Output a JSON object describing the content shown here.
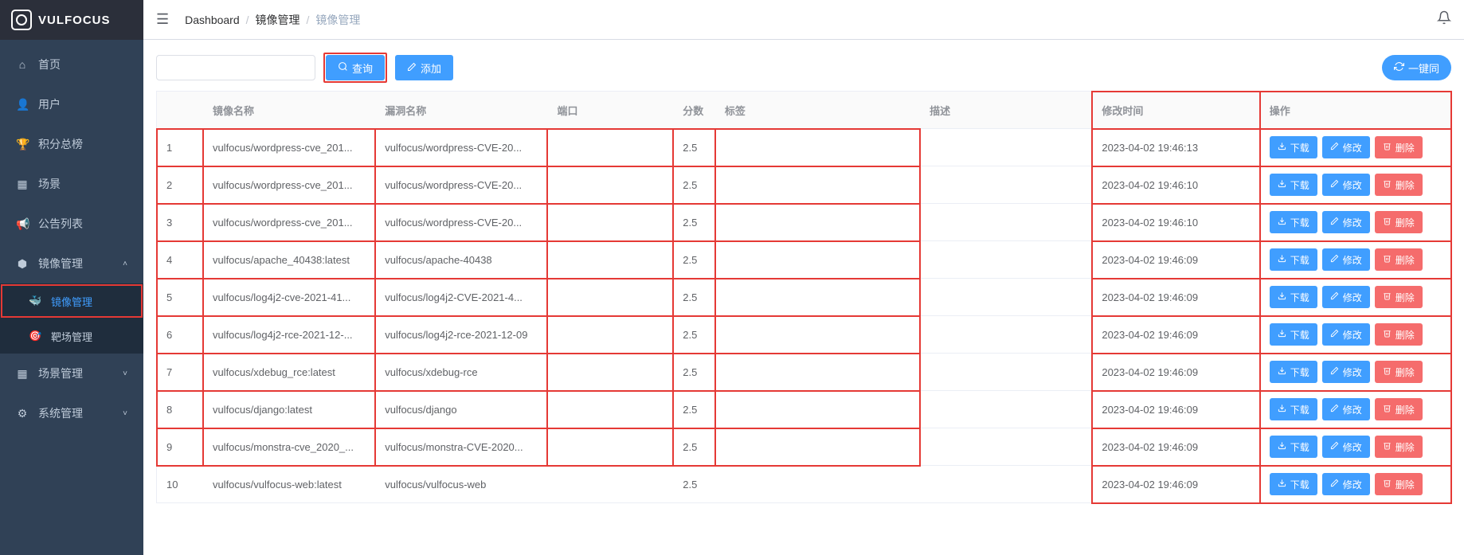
{
  "app": {
    "title": "VULFOCUS"
  },
  "sidebar": {
    "items": [
      {
        "icon": "⌂",
        "label": "首页",
        "name": "home"
      },
      {
        "icon": "👤",
        "label": "用户",
        "name": "users"
      },
      {
        "icon": "🏆",
        "label": "积分总榜",
        "name": "scoreboard"
      },
      {
        "icon": "▦",
        "label": "场景",
        "name": "scene"
      },
      {
        "icon": "📢",
        "label": "公告列表",
        "name": "announcements"
      },
      {
        "icon": "⬢",
        "label": "镜像管理",
        "name": "image-mgmt",
        "expanded": true,
        "children": [
          {
            "icon": "🐳",
            "label": "镜像管理",
            "name": "image-mgmt-sub",
            "active": true
          },
          {
            "icon": "🎯",
            "label": "靶场管理",
            "name": "range-mgmt"
          }
        ]
      },
      {
        "icon": "▦",
        "label": "场景管理",
        "name": "scene-mgmt",
        "expandable": true
      },
      {
        "icon": "⚙",
        "label": "系统管理",
        "name": "system-mgmt",
        "expandable": true
      }
    ]
  },
  "breadcrumb": {
    "items": [
      "Dashboard",
      "镜像管理",
      "镜像管理"
    ]
  },
  "toolbar": {
    "search_placeholder": "",
    "query_label": "查询",
    "add_label": "添加",
    "sync_label": "一键同"
  },
  "table": {
    "headers": {
      "name": "镜像名称",
      "vuln": "漏洞名称",
      "port": "端口",
      "score": "分数",
      "tag": "标签",
      "desc": "描述",
      "mtime": "修改时间",
      "op": "操作"
    },
    "op_labels": {
      "download": "下载",
      "edit": "修改",
      "delete": "删除"
    },
    "rows": [
      {
        "idx": 1,
        "name": "vulfocus/wordpress-cve_201...",
        "vuln": "vulfocus/wordpress-CVE-20...",
        "port": "",
        "score": "2.5",
        "tag": "",
        "desc": "",
        "mtime": "2023-04-02 19:46:13"
      },
      {
        "idx": 2,
        "name": "vulfocus/wordpress-cve_201...",
        "vuln": "vulfocus/wordpress-CVE-20...",
        "port": "",
        "score": "2.5",
        "tag": "",
        "desc": "",
        "mtime": "2023-04-02 19:46:10"
      },
      {
        "idx": 3,
        "name": "vulfocus/wordpress-cve_201...",
        "vuln": "vulfocus/wordpress-CVE-20...",
        "port": "",
        "score": "2.5",
        "tag": "",
        "desc": "",
        "mtime": "2023-04-02 19:46:10"
      },
      {
        "idx": 4,
        "name": "vulfocus/apache_40438:latest",
        "vuln": "vulfocus/apache-40438",
        "port": "",
        "score": "2.5",
        "tag": "",
        "desc": "",
        "mtime": "2023-04-02 19:46:09"
      },
      {
        "idx": 5,
        "name": "vulfocus/log4j2-cve-2021-41...",
        "vuln": "vulfocus/log4j2-CVE-2021-4...",
        "port": "",
        "score": "2.5",
        "tag": "",
        "desc": "",
        "mtime": "2023-04-02 19:46:09"
      },
      {
        "idx": 6,
        "name": "vulfocus/log4j2-rce-2021-12-...",
        "vuln": "vulfocus/log4j2-rce-2021-12-09",
        "port": "",
        "score": "2.5",
        "tag": "",
        "desc": "",
        "mtime": "2023-04-02 19:46:09"
      },
      {
        "idx": 7,
        "name": "vulfocus/xdebug_rce:latest",
        "vuln": "vulfocus/xdebug-rce",
        "port": "",
        "score": "2.5",
        "tag": "",
        "desc": "",
        "mtime": "2023-04-02 19:46:09"
      },
      {
        "idx": 8,
        "name": "vulfocus/django:latest",
        "vuln": "vulfocus/django",
        "port": "",
        "score": "2.5",
        "tag": "",
        "desc": "",
        "mtime": "2023-04-02 19:46:09"
      },
      {
        "idx": 9,
        "name": "vulfocus/monstra-cve_2020_...",
        "vuln": "vulfocus/monstra-CVE-2020...",
        "port": "",
        "score": "2.5",
        "tag": "",
        "desc": "",
        "mtime": "2023-04-02 19:46:09"
      },
      {
        "idx": 10,
        "name": "vulfocus/vulfocus-web:latest",
        "vuln": "vulfocus/vulfocus-web",
        "port": "",
        "score": "2.5",
        "tag": "",
        "desc": "",
        "mtime": "2023-04-02 19:46:09"
      }
    ]
  }
}
